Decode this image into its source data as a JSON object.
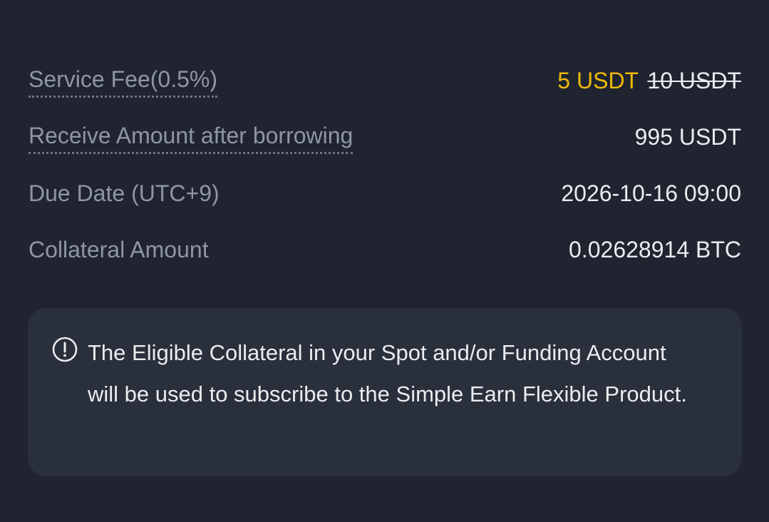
{
  "details": {
    "service_fee": {
      "label": "Service Fee(0.5%)",
      "value_discounted": "5 USDT",
      "value_original": "10 USDT"
    },
    "receive_amount": {
      "label": "Receive Amount after borrowing",
      "value": "995 USDT"
    },
    "due_date": {
      "label": "Due Date (UTC+9)",
      "value": "2026-10-16 09:00"
    },
    "collateral_amount": {
      "label": "Collateral Amount",
      "value": "0.02628914 BTC"
    }
  },
  "notice": {
    "icon": "info-circle-icon",
    "text": "The Eligible Collateral in your Spot and/or Funding Account will be used to subscribe to the Simple Earn Flexible Product."
  },
  "colors": {
    "background": "#1f2430",
    "card": "#292f3b",
    "accent": "#f0b90b",
    "label": "#8f96a3",
    "text": "#eaecef"
  }
}
